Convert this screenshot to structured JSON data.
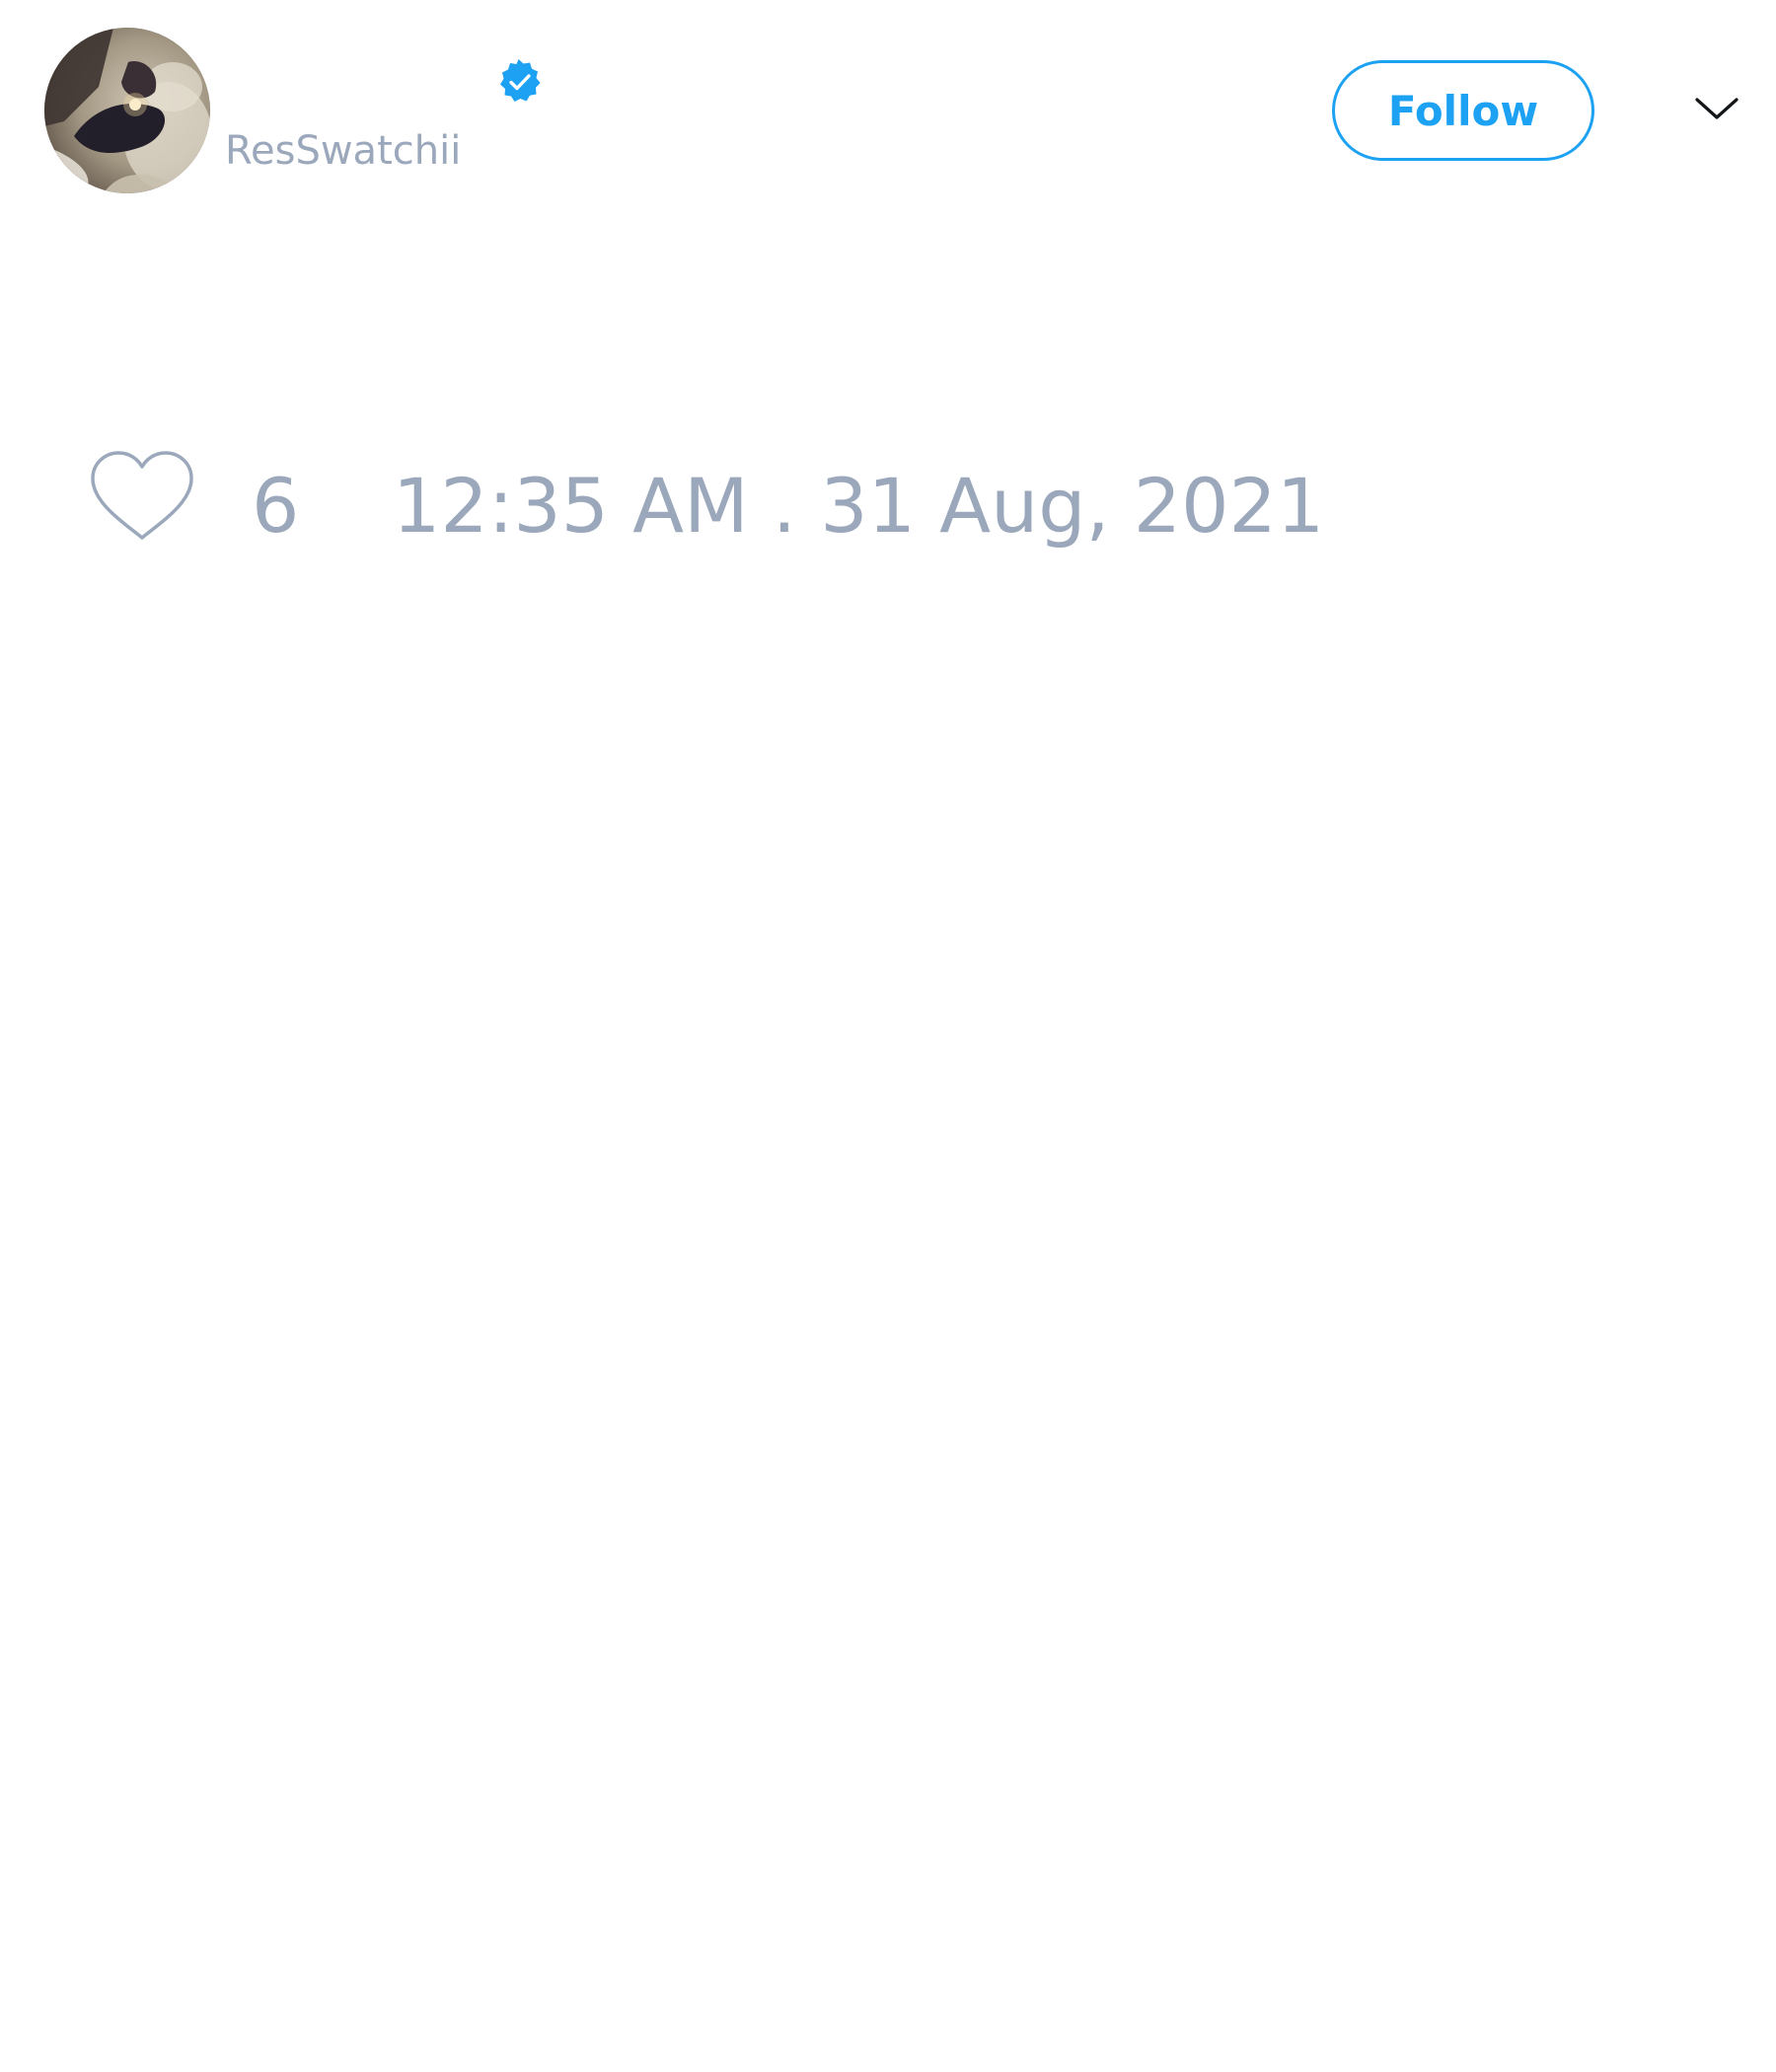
{
  "tweet": {
    "author": {
      "display_name": "",
      "username": "ResSwatchii",
      "verified": true,
      "avatar_icon": "profile-photo"
    },
    "header": {
      "follow_label": "Follow",
      "menu_icon": "chevron-down-icon"
    },
    "stats": {
      "like_icon": "heart-outline-icon",
      "likes": "6",
      "timestamp": "12:35 AM . 31 Aug, 2021"
    }
  },
  "colors": {
    "accent": "#1da1f2",
    "muted_text": "#9ba8bb",
    "background": "#ffffff",
    "icon_dark": "#14171a"
  }
}
